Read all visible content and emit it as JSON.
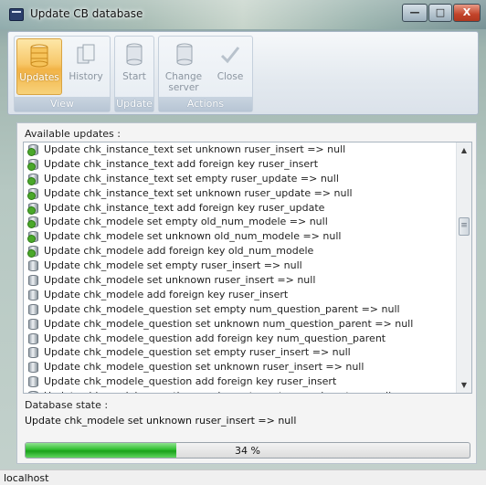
{
  "window": {
    "title": "Update CB database",
    "minimize_glyph": "—",
    "maximize_glyph": "□",
    "close_glyph": "X"
  },
  "ribbon": {
    "groups": [
      {
        "caption": "View",
        "buttons": [
          {
            "label": "Updates",
            "icon": "database-stack-icon",
            "active": true
          },
          {
            "label": "History",
            "icon": "history-icon",
            "active": false
          }
        ]
      },
      {
        "caption": "Update",
        "buttons": [
          {
            "label": "Start",
            "icon": "start-database-icon",
            "active": false
          }
        ]
      },
      {
        "caption": "Actions",
        "buttons": [
          {
            "label": "Change server",
            "icon": "server-icon",
            "active": false
          },
          {
            "label": "Close",
            "icon": "checkmark-icon",
            "active": false
          }
        ]
      }
    ]
  },
  "updates": {
    "label": "Available updates :",
    "items": [
      {
        "text": "Update chk_instance_text set unknown ruser_insert => null",
        "done": true
      },
      {
        "text": "Update chk_instance_text add foreign key ruser_insert",
        "done": true
      },
      {
        "text": "Update chk_instance_text set empty ruser_update => null",
        "done": true
      },
      {
        "text": "Update chk_instance_text set unknown ruser_update => null",
        "done": true
      },
      {
        "text": "Update chk_instance_text add foreign key ruser_update",
        "done": true
      },
      {
        "text": "Update chk_modele set empty old_num_modele => null",
        "done": true
      },
      {
        "text": "Update chk_modele set unknown old_num_modele => null",
        "done": true
      },
      {
        "text": "Update chk_modele add foreign key old_num_modele",
        "done": true
      },
      {
        "text": "Update chk_modele set empty ruser_insert => null",
        "done": false
      },
      {
        "text": "Update chk_modele set unknown ruser_insert => null",
        "done": false
      },
      {
        "text": "Update chk_modele add foreign key ruser_insert",
        "done": false
      },
      {
        "text": "Update chk_modele_question set empty num_question_parent => null",
        "done": false
      },
      {
        "text": "Update chk_modele_question set unknown num_question_parent => null",
        "done": false
      },
      {
        "text": "Update chk_modele_question add foreign key num_question_parent",
        "done": false
      },
      {
        "text": "Update chk_modele_question set empty ruser_insert => null",
        "done": false
      },
      {
        "text": "Update chk_modele_question set unknown ruser_insert => null",
        "done": false
      },
      {
        "text": "Update chk_modele_question add foreign key ruser_insert",
        "done": false
      },
      {
        "text": "Update chk_modele_question number set empty ruser insert => null",
        "done": false
      }
    ],
    "scroll_up_glyph": "▲",
    "scroll_down_glyph": "▼",
    "scroll_thumb_glyph": "≡"
  },
  "state": {
    "label": "Database state :",
    "value": "Update chk_modele set unknown ruser_insert => null"
  },
  "progress": {
    "percent": 34,
    "text": "34 %"
  },
  "status": {
    "server": "localhost"
  },
  "colors": {
    "progress_fill": "#2fbe2f",
    "active_button": "#f7c769",
    "done_marker": "#4aa82a"
  }
}
